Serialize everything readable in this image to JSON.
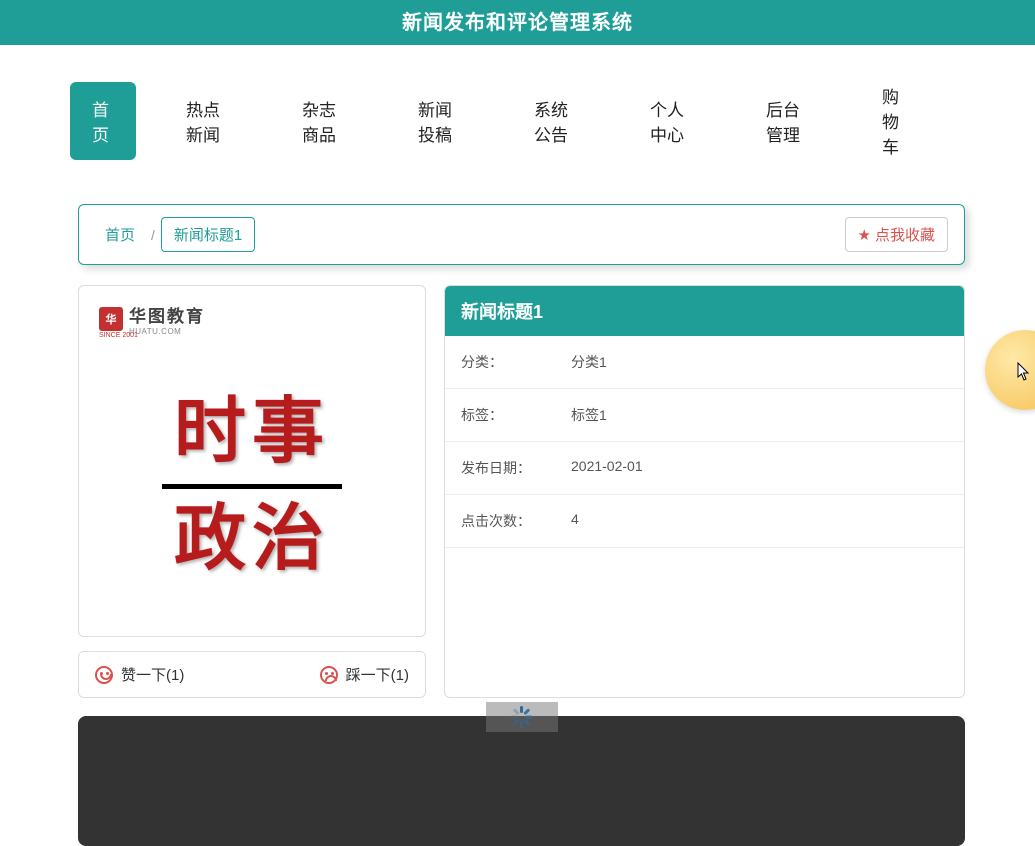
{
  "header": {
    "title": "新闻发布和评论管理系统"
  },
  "nav": {
    "items": [
      {
        "label": "首页",
        "active": true
      },
      {
        "label": "热点新闻",
        "active": false
      },
      {
        "label": "杂志商品",
        "active": false
      },
      {
        "label": "新闻投稿",
        "active": false
      },
      {
        "label": "系统公告",
        "active": false
      },
      {
        "label": "个人中心",
        "active": false
      },
      {
        "label": "后台管理",
        "active": false
      },
      {
        "label": "购物车",
        "active": false
      }
    ]
  },
  "breadcrumb": {
    "home": "首页",
    "separator": "/",
    "current": "新闻标题1"
  },
  "favorite": {
    "label": "点我收藏"
  },
  "image_card": {
    "logo_brand": "华图教育",
    "logo_domain": "HUATU.COM",
    "since": "SINCE 2001",
    "big_line1": "时事",
    "big_line2": "政治"
  },
  "article": {
    "title": "新闻标题1",
    "fields": [
      {
        "label": "分类：",
        "value": "分类1"
      },
      {
        "label": "标签：",
        "value": "标签1"
      },
      {
        "label": "发布日期：",
        "value": "2021-02-01"
      },
      {
        "label": "点击次数：",
        "value": "4"
      }
    ]
  },
  "vote": {
    "like": "赞一下(1)",
    "dislike": "踩一下(1)"
  }
}
